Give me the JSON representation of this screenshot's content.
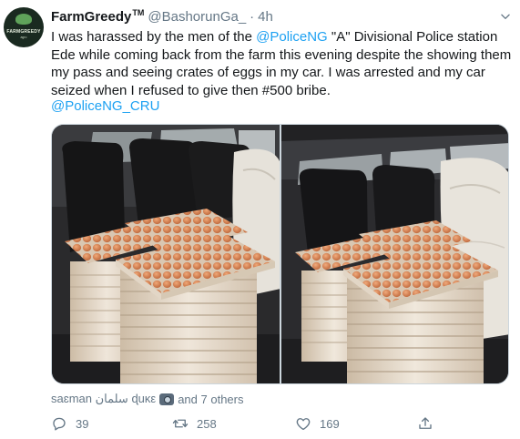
{
  "tweet": {
    "display_name": "FarmGreedy",
    "verified_mark": "TM",
    "handle": "@BashorunGa_",
    "separator": "·",
    "time": "4h",
    "text_parts": [
      "I was harassed by the men of the ",
      "@PoliceNG",
      " \"A\" Divisional Police station Ede while coming back from the farm this evening despite the showing them my pass and seeing crates of eggs in my car. I was arrested and my car seized when I refused to give then #500 bribe."
    ],
    "mention_line": "@PoliceNG_CRU",
    "avatar": {
      "line1": "FARMGREEDY",
      "line2": "agro"
    }
  },
  "tags": {
    "names": "saɛman سلمان ɖuκε",
    "suffix": "and 7 others"
  },
  "actions": {
    "reply_count": "39",
    "retweet_count": "258",
    "like_count": "169",
    "share_label": ""
  },
  "colors": {
    "link": "#1da1f2",
    "secondary": "#657786",
    "egg": "#d98a5a",
    "tray": "#efe6da"
  },
  "icons": {
    "chevron": "chevron-down-icon",
    "reply": "reply-icon",
    "retweet": "retweet-icon",
    "like": "heart-icon",
    "share": "share-icon",
    "tag": "camera-emoji-icon"
  }
}
